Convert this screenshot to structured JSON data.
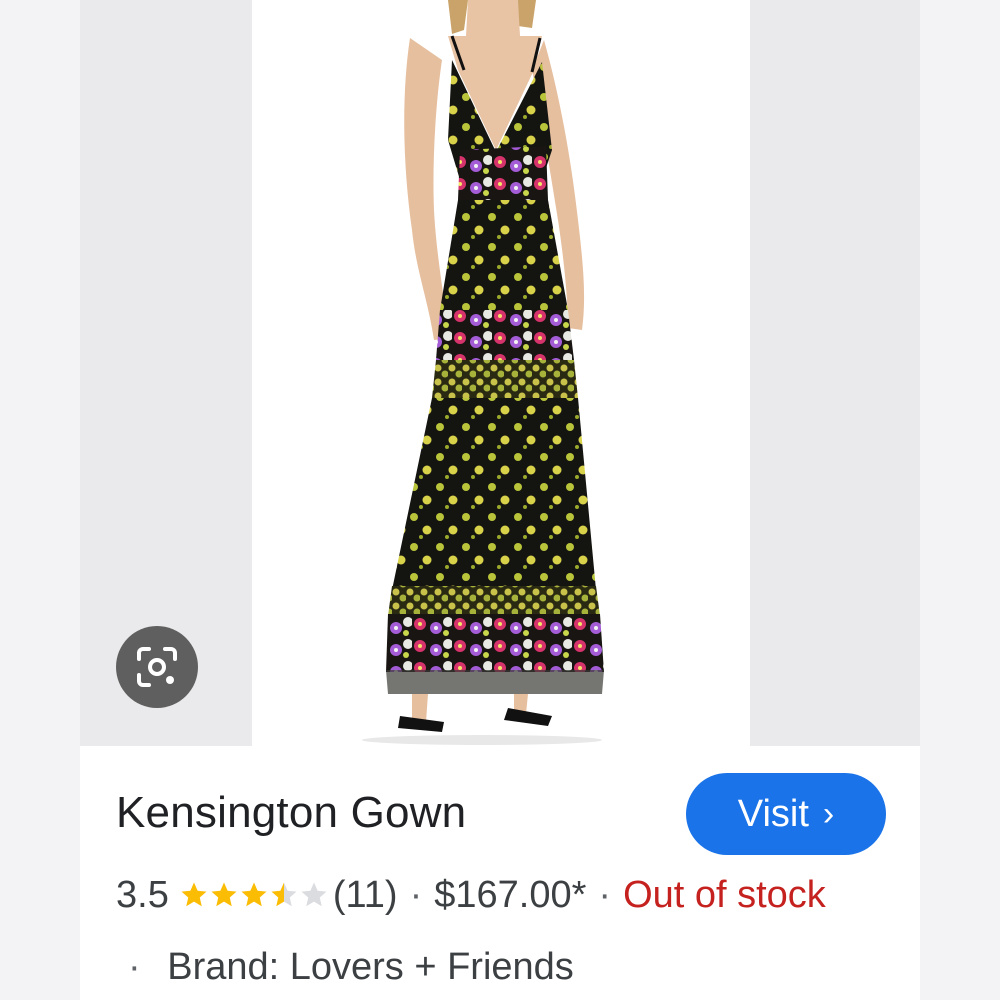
{
  "product": {
    "title": "Kensington Gown",
    "rating_value": "3.5",
    "rating": 3.5,
    "review_count": "(11)",
    "price": "$167.00*",
    "availability": "Out of stock",
    "separator": "·",
    "brand": "Brand: Lovers + Friends"
  },
  "actions": {
    "visit_label": "Visit",
    "visit_chevron": "›",
    "lens_icon": "google-lens-icon"
  },
  "colors": {
    "visit_button": "#1a73e8",
    "out_of_stock": "#c5221f",
    "star_filled": "#fbbc04",
    "star_empty": "#dadce0"
  }
}
